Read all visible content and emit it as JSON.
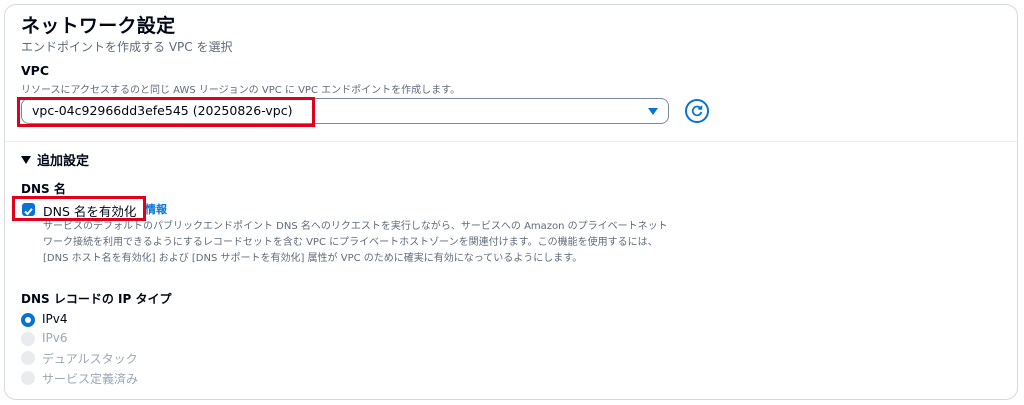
{
  "network": {
    "title": "ネットワーク設定",
    "subtitle": "エンドポイントを作成する VPC を選択",
    "vpc_label": "VPC",
    "vpc_description": "リソースにアクセスするのと同じ AWS リージョンの VPC に VPC エンドポイントを作成します。",
    "vpc_selected": "vpc-04c92966dd3efe545 (20250826-vpc)"
  },
  "additional": {
    "toggle_label": "追加設定",
    "dns_name_label": "DNS 名",
    "checkbox_label": "DNS 名を有効化",
    "checkbox_checked": true,
    "info_link": "情報",
    "checkbox_description": "サービスのデフォルトのパブリックエンドポイント DNS 名へのリクエストを実行しながら、サービスへの Amazon のプライベートネットワーク接続を利用できるようにするレコードセットを含む VPC にプライベートホストゾーンを関連付けます。この機能を使用するには、[DNS ホスト名を有効化] および [DNS サポートを有効化] 属性が VPC のために確実に有効になっているようにします。",
    "ip_type_label": "DNS レコードの IP タイプ",
    "ip_options": [
      {
        "label": "IPv4",
        "selected": true,
        "disabled": false
      },
      {
        "label": "IPv6",
        "selected": false,
        "disabled": true
      },
      {
        "label": "デュアルスタック",
        "selected": false,
        "disabled": true
      },
      {
        "label": "サービス定義済み",
        "selected": false,
        "disabled": true
      }
    ]
  },
  "colors": {
    "accent": "#0972d3",
    "highlight": "#e0001b",
    "muted": "#5f6b7a",
    "disabled": "#9ba7b6"
  }
}
